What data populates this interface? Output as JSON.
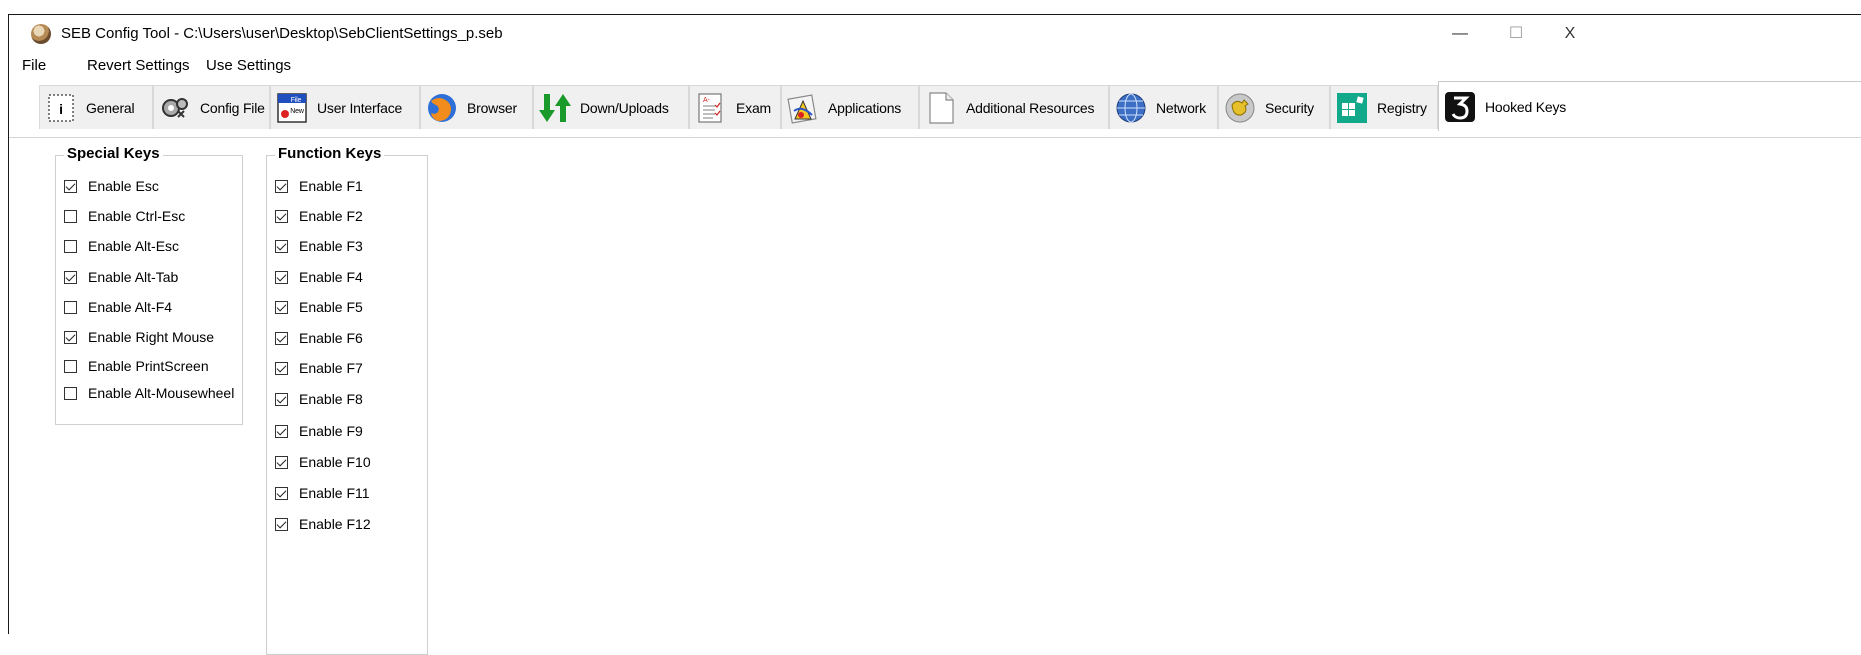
{
  "window": {
    "title": "SEB Config Tool - C:\\Users\\user\\Desktop\\SebClientSettings_p.seb",
    "app_icon": "seb-icon",
    "minimize_glyph": "—",
    "maximize_glyph": "☐",
    "close_glyph": "X"
  },
  "menu": [
    {
      "label": "File"
    },
    {
      "label": "Revert Settings"
    },
    {
      "label": "Use Settings"
    }
  ],
  "tabs": [
    {
      "label": "General",
      "icon": "general-icon"
    },
    {
      "label": "Config File",
      "icon": "config-file-icon"
    },
    {
      "label": "User Interface",
      "icon": "user-interface-icon"
    },
    {
      "label": "Browser",
      "icon": "browser-icon"
    },
    {
      "label": "Down/Uploads",
      "icon": "down-uploads-icon"
    },
    {
      "label": "Exam",
      "icon": "exam-icon"
    },
    {
      "label": "Applications",
      "icon": "applications-icon"
    },
    {
      "label": "Additional Resources",
      "icon": "additional-resources-icon"
    },
    {
      "label": "Network",
      "icon": "network-icon"
    },
    {
      "label": "Security",
      "icon": "security-icon"
    },
    {
      "label": "Registry",
      "icon": "registry-icon"
    },
    {
      "label": "Hooked Keys",
      "icon": "hooked-keys-icon",
      "active": true
    }
  ],
  "special_keys": {
    "title": "Special Keys",
    "items": [
      {
        "label": "Enable Esc",
        "checked": true
      },
      {
        "label": "Enable Ctrl-Esc",
        "checked": false
      },
      {
        "label": "Enable Alt-Esc",
        "checked": false
      },
      {
        "label": "Enable Alt-Tab",
        "checked": true
      },
      {
        "label": "Enable Alt-F4",
        "checked": false
      },
      {
        "label": "Enable Right Mouse",
        "checked": true
      },
      {
        "label": "Enable PrintScreen",
        "checked": false
      },
      {
        "label": "Enable Alt-Mousewheel",
        "checked": false
      }
    ]
  },
  "function_keys": {
    "title": "Function Keys",
    "items": [
      {
        "label": "Enable F1",
        "checked": true
      },
      {
        "label": "Enable F2",
        "checked": true
      },
      {
        "label": "Enable F3",
        "checked": true
      },
      {
        "label": "Enable F4",
        "checked": true
      },
      {
        "label": "Enable F5",
        "checked": true
      },
      {
        "label": "Enable F6",
        "checked": true
      },
      {
        "label": "Enable F7",
        "checked": true
      },
      {
        "label": "Enable F8",
        "checked": true
      },
      {
        "label": "Enable F9",
        "checked": true
      },
      {
        "label": "Enable F10",
        "checked": true
      },
      {
        "label": "Enable F11",
        "checked": true
      },
      {
        "label": "Enable F12",
        "checked": true
      }
    ]
  }
}
